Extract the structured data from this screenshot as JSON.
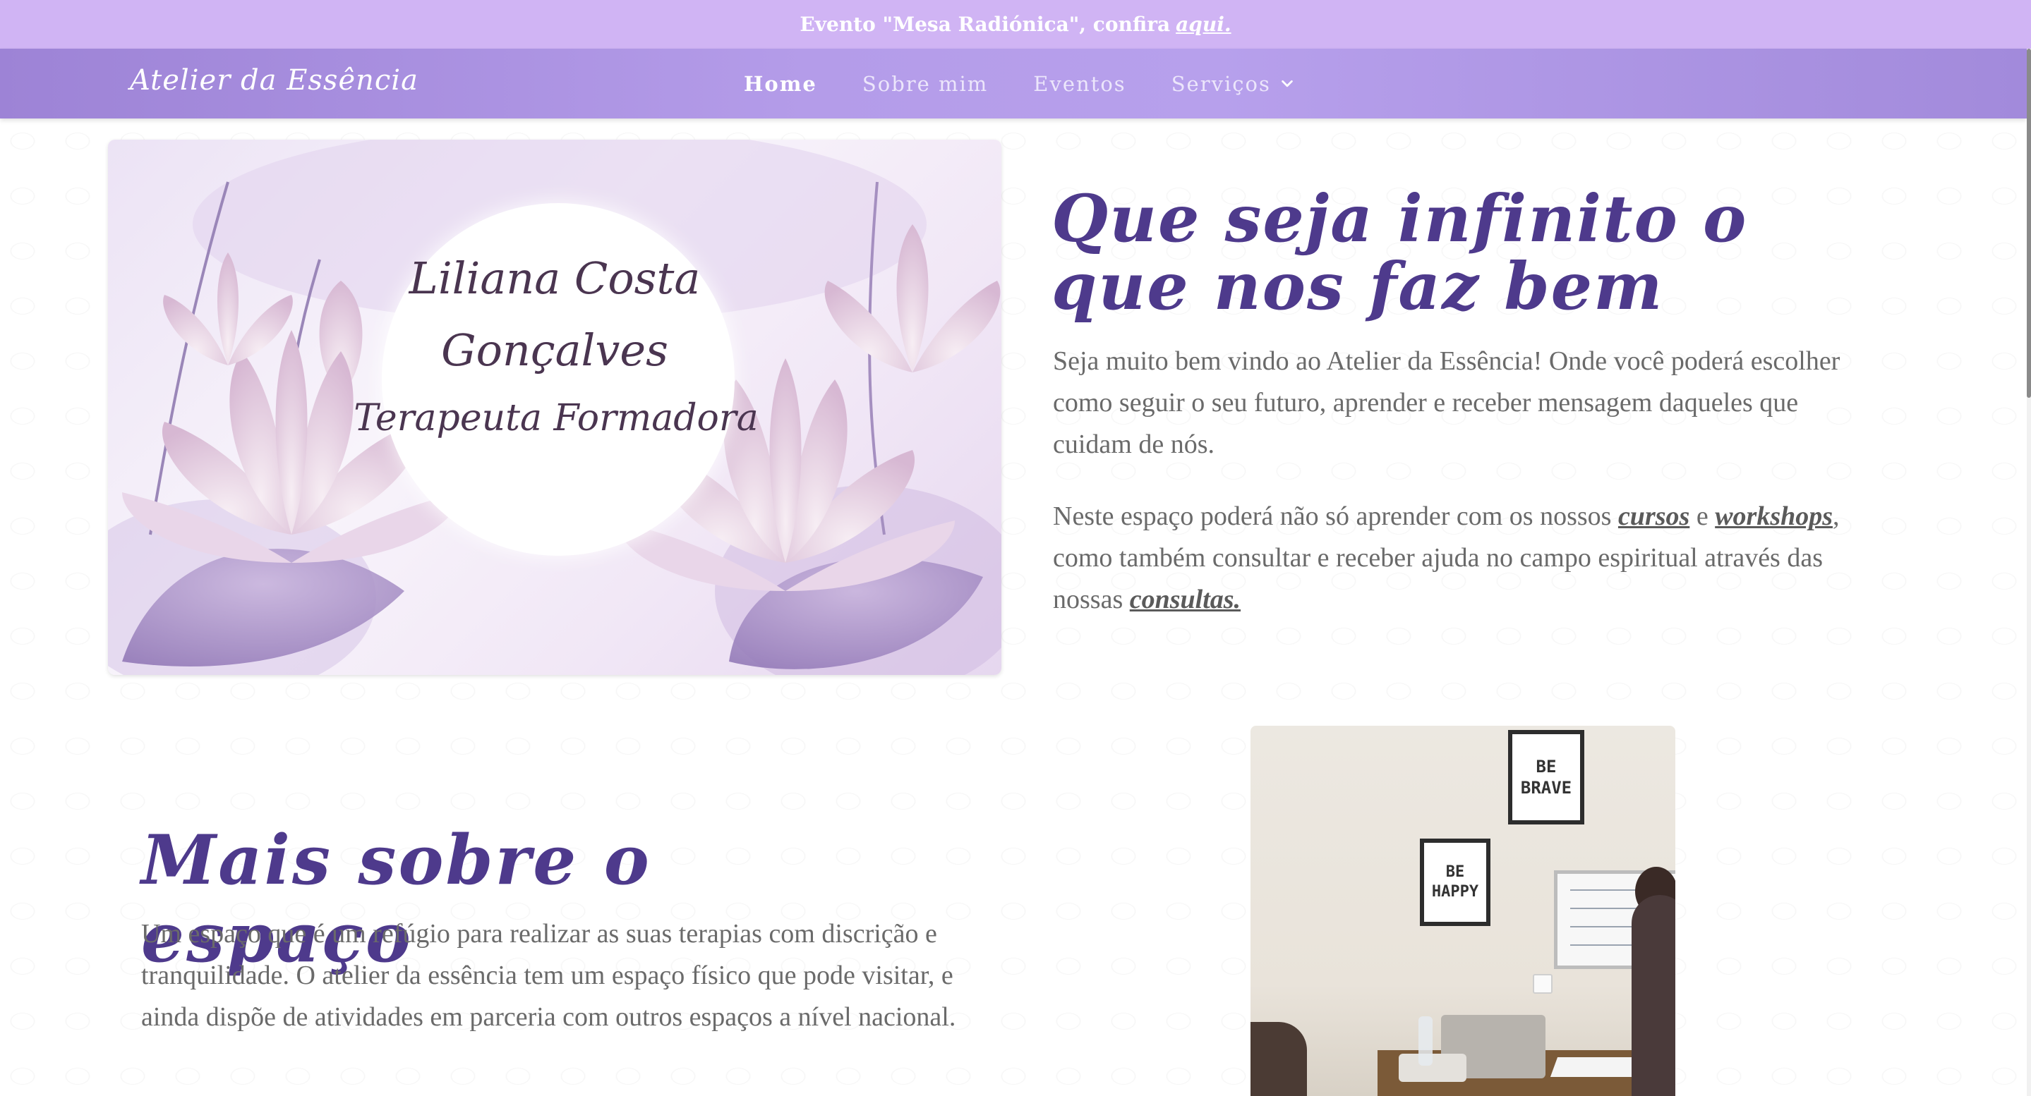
{
  "announcement": {
    "text": "Evento \"Mesa Radiónica\", confira",
    "link": "aqui."
  },
  "nav": {
    "brand": "Atelier da Essência",
    "links": [
      {
        "label": "Home",
        "active": true
      },
      {
        "label": "Sobre mim",
        "active": false
      },
      {
        "label": "Eventos",
        "active": false
      },
      {
        "label": "Serviços",
        "active": false,
        "dropdown": true
      }
    ]
  },
  "hero_image": {
    "line1": "Liliana Costa",
    "line2": "Gonçalves",
    "line3": "Terapeuta Formadora"
  },
  "intro": {
    "title": "Que seja infinito o que nos faz bem",
    "paragraph1": "Seja muito bem vindo ao Atelier da Essência! Onde você poderá escolher como seguir o seu futuro, aprender e receber mensagem daqueles que cuidam de nós.",
    "paragraph2_part1": "Neste espaço poderá não só aprender com os nossos",
    "link_cursos": "cursos",
    "paragraph2_part2": "e",
    "link_workshops": "workshops",
    "paragraph2_part3": ", como também consultar e receber ajuda no campo espiritual através das nossas",
    "link_consultas": "consultas."
  },
  "space": {
    "title": "Mais sobre o espaço",
    "paragraph": "Um espaço que é um refúgio para realizar as suas terapias com discrição e tranquilidade. O atelier da essência tem um espaço físico que pode visitar, e ainda dispõe de atividades em parceria com outros espaços a nível nacional.",
    "poster1": [
      "BE",
      "BRAVE"
    ],
    "poster2": [
      "BE",
      "HAPPY"
    ]
  },
  "colors": {
    "announcement_bg": "#d0b4f4",
    "nav_bg": "#b49ce9",
    "heading": "#4e3a8c",
    "body_text": "#6a6a6a"
  }
}
